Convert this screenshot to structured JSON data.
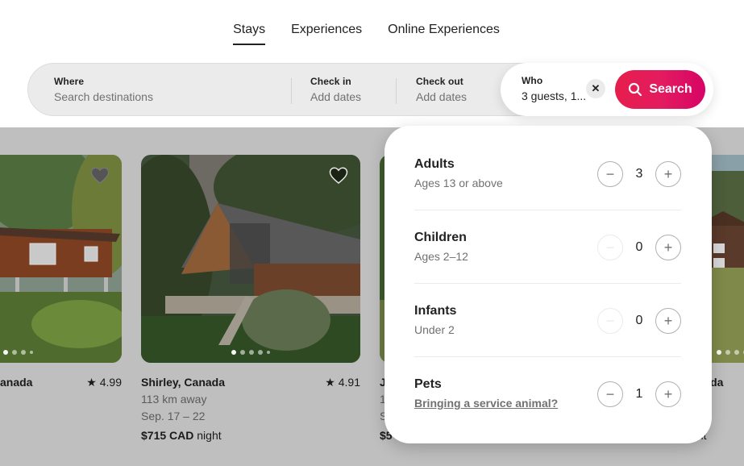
{
  "tabs": [
    {
      "label": "Stays",
      "active": true
    },
    {
      "label": "Experiences",
      "active": false
    },
    {
      "label": "Online Experiences",
      "active": false
    }
  ],
  "search": {
    "where_label": "Where",
    "where_placeholder": "Search destinations",
    "checkin_label": "Check in",
    "checkin_value": "Add dates",
    "checkout_label": "Check out",
    "checkout_value": "Add dates",
    "who_label": "Who",
    "who_value": "3 guests, 1...",
    "clear_icon": "close-icon",
    "button_label": "Search",
    "button_color": "#e31c5f"
  },
  "guests": [
    {
      "name": "Adults",
      "desc": "Ages 13 or above",
      "count": "3",
      "minus_enabled": true
    },
    {
      "name": "Children",
      "desc": "Ages 2–12",
      "count": "0",
      "minus_enabled": false
    },
    {
      "name": "Infants",
      "desc": "Under 2",
      "count": "0",
      "minus_enabled": false
    },
    {
      "name": "Pets",
      "desc": "Bringing a service animal?",
      "count": "1",
      "minus_enabled": true
    }
  ],
  "listings": [
    {
      "title": "anada",
      "rating": "4.99",
      "distance": "",
      "dates": "",
      "price": "",
      "price_unit": ""
    },
    {
      "title": "Shirley, Canada",
      "rating": "4.91",
      "distance": "113 km away",
      "dates": "Sep. 17 – 22",
      "price": "$715 CAD",
      "price_unit": "night"
    },
    {
      "title": "J",
      "rating": "",
      "distance": "1",
      "dates": "S",
      "price": "$5",
      "price_unit": ""
    },
    {
      "title": "anada",
      "rating": "",
      "distance": "",
      "dates": "",
      "price": "",
      "price_unit": "ght"
    }
  ],
  "icons": {
    "heart": "heart-icon",
    "star": "star-icon",
    "search": "search-icon"
  }
}
